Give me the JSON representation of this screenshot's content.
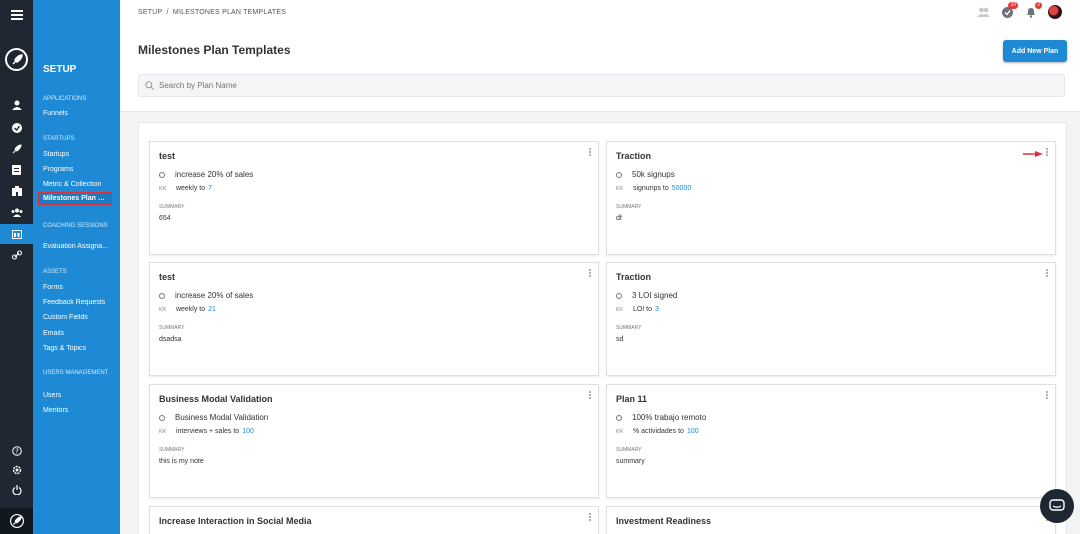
{
  "breadcrumb": "SETUP  /  MILESTONES PLAN TEMPLATES",
  "page_title": "Milestones Plan Templates",
  "add_button": "Add New Plan",
  "search": {
    "placeholder": "Search by Plan Name"
  },
  "notifications": {
    "tasks_count": "10",
    "alerts_count": "2"
  },
  "sidebar": {
    "title": "SETUP",
    "sections": [
      {
        "label": "APPLICATIONS",
        "items": [
          "Funnels"
        ]
      },
      {
        "label": "STARTUPS",
        "items": [
          "Startups",
          "Programs",
          "Metric & Collection",
          "Milestones Plan T..."
        ]
      },
      {
        "label": "COACHING SESSIONS",
        "items": [
          "Evaluation Assigna..."
        ]
      },
      {
        "label": "ASSETS",
        "items": [
          "Forms",
          "Feedback Requests",
          "Custom Fields",
          "Emails",
          "Tags & Topics"
        ]
      },
      {
        "label": "USERS MANAGEMENT",
        "items": [
          "Users",
          "Mentors"
        ]
      }
    ],
    "selected": "Milestones Plan T..."
  },
  "icons": {
    "rail": [
      "menu-icon",
      "rocket-logo-icon",
      "user-icon",
      "check-circle-icon",
      "rocket-icon",
      "document-icon",
      "building-icon",
      "team-icon",
      "calendar-icon",
      "link-icon",
      "help-icon",
      "settings-icon",
      "power-icon",
      "rocket-logo-icon"
    ],
    "top": [
      "users-icon",
      "task-check-icon",
      "bell-icon",
      "avatar"
    ]
  },
  "colors": {
    "accent": "#1e8ad6",
    "rail": "#1f2733",
    "annotation": "#d9333f"
  },
  "summary_label": "SUMMARY",
  "kr_label": "KR",
  "cards": [
    {
      "title": "test",
      "objective": "increase 20% of sales",
      "kr": "weekly to",
      "target": "7",
      "summary": "654"
    },
    {
      "title": "Traction",
      "objective": "50k signups",
      "kr": "signunps to",
      "target": "50000",
      "summary": "df"
    },
    {
      "title": "test",
      "objective": "increase 20% of sales",
      "kr": "weekly to",
      "target": "21",
      "summary": "dsadsa"
    },
    {
      "title": "Traction",
      "objective": "3 LOI signed",
      "kr": "LOI to",
      "target": "3",
      "summary": "sd"
    },
    {
      "title": "Business Modal Validation",
      "objective": "Business Modal Validation",
      "kr": "interviews + sales to",
      "target": "100",
      "summary": "this is my note"
    },
    {
      "title": "Plan 11",
      "objective": "100% trabajo remoto",
      "kr": "% actividades to",
      "target": "100",
      "summary": "summary"
    },
    {
      "title": "Increase Interaction in Social Media"
    },
    {
      "title": "Investment Readiness"
    }
  ]
}
